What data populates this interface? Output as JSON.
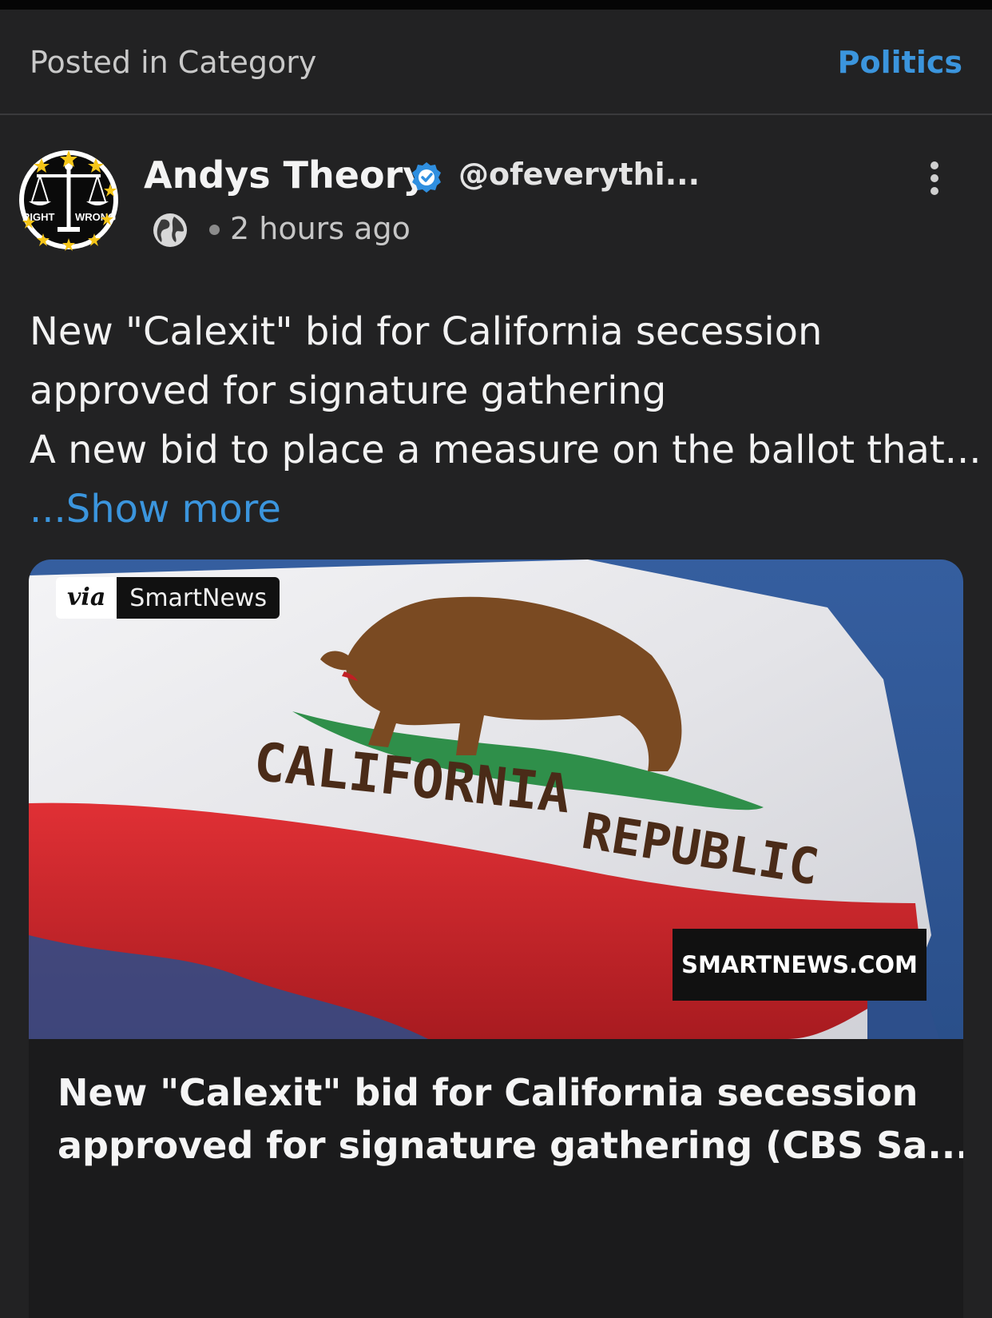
{
  "category_bar": {
    "label": "Posted in Category",
    "value": "Politics"
  },
  "author": {
    "avatar_text_left": "RIGHT",
    "avatar_text_right": "WRONG",
    "name": "Andys Theory",
    "handle": "@ofeverythi...",
    "time": "2 hours ago",
    "visibility_icon": "globe-icon",
    "verified_icon": "verified-badge-icon"
  },
  "post": {
    "line1": "New \"Calexit\" bid for California secession",
    "line2": "approved for signature gathering",
    "line3": "A new bid to place a measure on the ballot that...",
    "show_more": "...Show more"
  },
  "link_card": {
    "via_label": "via",
    "source_label": "SmartNews",
    "flag_text_1": "CALIFORNIA",
    "flag_text_2": "REPUBLIC",
    "image_stamp": "SMARTNEWS.COM",
    "title_line1": "New \"Calexit\" bid for California secession",
    "title_line2": "approved for signature gathering (CBS Sa..."
  },
  "colors": {
    "background": "#222223",
    "accent": "#3b95dd",
    "flag_red": "#c8252a",
    "sky": "#2e4f8c"
  }
}
